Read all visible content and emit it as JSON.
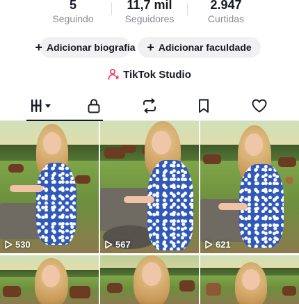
{
  "stats": [
    {
      "value": "5",
      "label": "Seguindo"
    },
    {
      "value": "11,7 mil",
      "label": "Seguidores"
    },
    {
      "value": "2.947",
      "label": "Curtidas"
    }
  ],
  "actions": {
    "add_bio": "Adicionar biografia",
    "add_faculty": "Adicionar faculdade",
    "plus_glyph": "+"
  },
  "studio": {
    "label": "TikTok Studio",
    "icon": "person-star-icon",
    "icon_color": "#fe2c55"
  },
  "tabs": [
    {
      "name": "videos",
      "icon": "grid-lines-icon",
      "active": true
    },
    {
      "name": "private",
      "icon": "lock-icon",
      "active": false
    },
    {
      "name": "reposts",
      "icon": "repost-icon",
      "active": false
    },
    {
      "name": "saved",
      "icon": "bookmark-icon",
      "active": false
    },
    {
      "name": "liked",
      "icon": "heart-outline-icon",
      "active": false
    }
  ],
  "videos": [
    {
      "views": "530"
    },
    {
      "views": "567"
    },
    {
      "views": "621"
    },
    {
      "views": ""
    },
    {
      "views": ""
    },
    {
      "views": ""
    }
  ],
  "colors": {
    "text_primary": "#161823",
    "text_secondary": "#8a8b91",
    "pill_background": "#f1f1f2",
    "accent": "#fe2c55"
  }
}
